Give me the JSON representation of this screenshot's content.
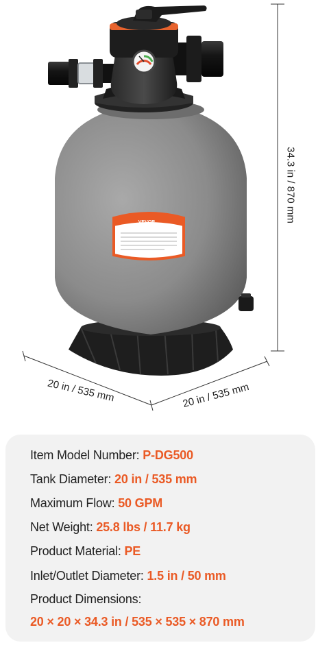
{
  "dimensions": {
    "height": "34.3 in / 870 mm",
    "width_left": "20 in / 535 mm",
    "width_right": "20 in / 535 mm"
  },
  "label_brand": "VEVOR",
  "colors": {
    "accent": "#ea5a25",
    "tank": "#8e8e8e",
    "base": "#1e1e1e"
  },
  "specs": [
    {
      "label": "Item Model Number: ",
      "value": "P-DG500"
    },
    {
      "label": "Tank Diameter: ",
      "value": "20 in / 535 mm"
    },
    {
      "label": "Maximum Flow: ",
      "value": "50 GPM"
    },
    {
      "label": "Net Weight: ",
      "value": "25.8 lbs / 11.7 kg"
    },
    {
      "label": "Product Material: ",
      "value": "PE"
    },
    {
      "label": "Inlet/Outlet Diameter: ",
      "value": "1.5 in / 50 mm"
    },
    {
      "label": "Product Dimensions:",
      "value": ""
    },
    {
      "label": "",
      "value": "20 × 20 × 34.3 in / 535 × 535 × 870 mm"
    }
  ]
}
